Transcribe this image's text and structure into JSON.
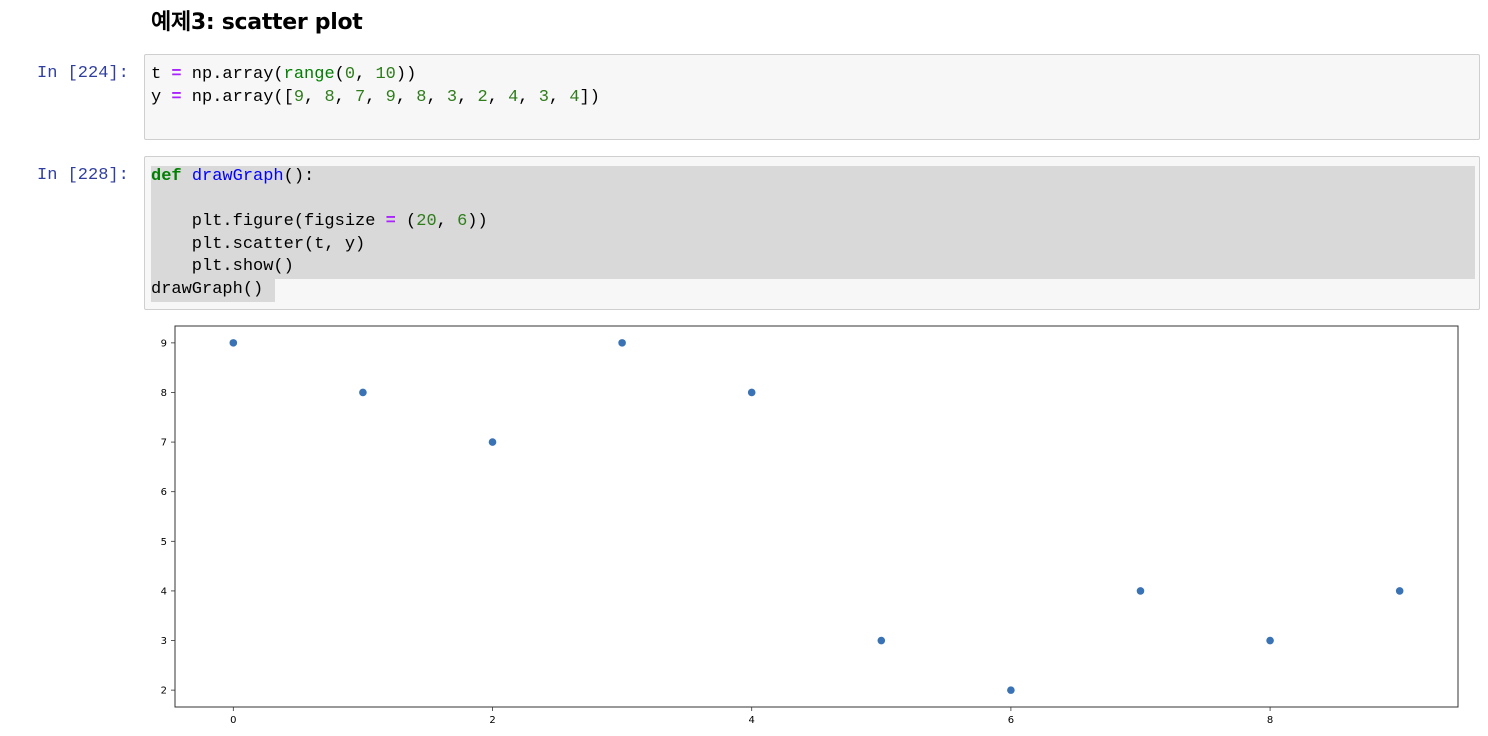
{
  "heading": "예제3: scatter plot",
  "cells": [
    {
      "prompt": "In [224]:",
      "lines": [
        [
          [
            "t",
            ""
          ],
          [
            " ",
            ""
          ],
          [
            "=",
            "op"
          ],
          [
            " np.array(",
            ""
          ],
          [
            "range",
            "bi"
          ],
          [
            "(",
            ""
          ],
          [
            "0",
            "num"
          ],
          [
            ", ",
            ""
          ],
          [
            "10",
            "num"
          ],
          [
            "))",
            ""
          ]
        ],
        [
          [
            "y",
            ""
          ],
          [
            " ",
            ""
          ],
          [
            "=",
            "op"
          ],
          [
            " np.array([",
            ""
          ],
          [
            "9",
            "num"
          ],
          [
            ", ",
            ""
          ],
          [
            "8",
            "num"
          ],
          [
            ", ",
            ""
          ],
          [
            "7",
            "num"
          ],
          [
            ", ",
            ""
          ],
          [
            "9",
            "num"
          ],
          [
            ", ",
            ""
          ],
          [
            "8",
            "num"
          ],
          [
            ", ",
            ""
          ],
          [
            "3",
            "num"
          ],
          [
            ", ",
            ""
          ],
          [
            "2",
            "num"
          ],
          [
            ", ",
            ""
          ],
          [
            "4",
            "num"
          ],
          [
            ", ",
            ""
          ],
          [
            "3",
            "num"
          ],
          [
            ", ",
            ""
          ],
          [
            "4",
            "num"
          ],
          [
            "])",
            ""
          ]
        ]
      ]
    },
    {
      "prompt": "In [228]:",
      "lines": [
        [
          [
            "def",
            "kw"
          ],
          [
            " ",
            ""
          ],
          [
            "drawGraph",
            "fn"
          ],
          [
            "():",
            ""
          ]
        ],
        [
          [
            "",
            ""
          ]
        ],
        [
          [
            "    plt.figure(figsize ",
            ""
          ],
          [
            "=",
            "op"
          ],
          [
            " (",
            ""
          ],
          [
            "20",
            "num"
          ],
          [
            ", ",
            ""
          ],
          [
            "6",
            "num"
          ],
          [
            "))",
            ""
          ]
        ],
        [
          [
            "    plt.scatter(t, y)",
            ""
          ]
        ],
        [
          [
            "    plt.show()",
            ""
          ]
        ],
        [
          [
            "drawGraph()",
            ""
          ]
        ]
      ]
    }
  ],
  "colors": {
    "prompt": "#303f9f",
    "marker": "#3a73b5",
    "keyword": "#008000",
    "function": "#0000ff",
    "operator": "#aa22ff",
    "number": "#2e7d1a"
  },
  "chart_data": {
    "type": "scatter",
    "x": [
      0,
      1,
      2,
      3,
      4,
      5,
      6,
      7,
      8,
      9
    ],
    "y": [
      9,
      8,
      7,
      9,
      8,
      3,
      2,
      4,
      3,
      4
    ],
    "xticks": [
      "0",
      "2",
      "4",
      "6",
      "8"
    ],
    "yticks": [
      "2",
      "3",
      "4",
      "5",
      "6",
      "7",
      "8",
      "9"
    ],
    "xlim": [
      -0.45,
      9.45
    ],
    "ylim": [
      1.66,
      9.34
    ],
    "title": "",
    "xlabel": "",
    "ylabel": "",
    "grid": false
  }
}
